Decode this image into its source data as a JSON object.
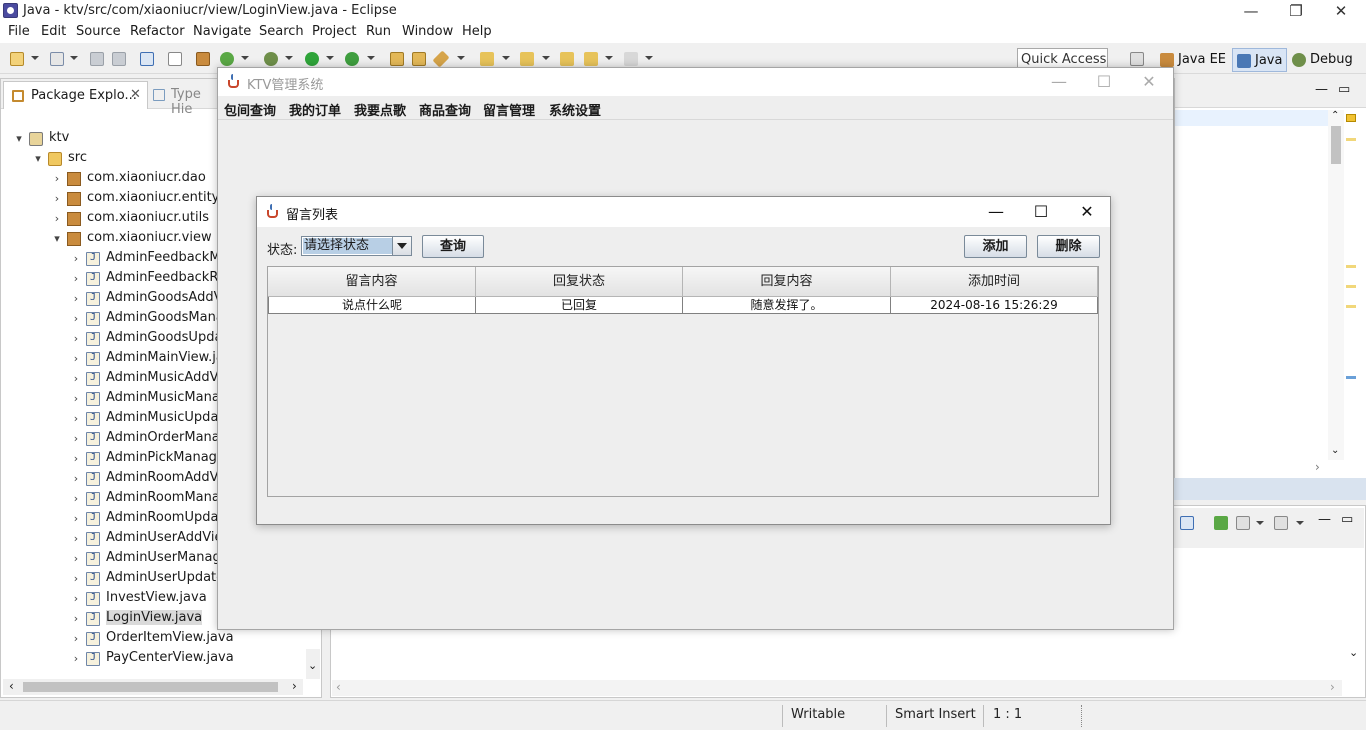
{
  "eclipse": {
    "title": "Java - ktv/src/com/xiaoniucr/view/LoginView.java - Eclipse",
    "menu": [
      "File",
      "Edit",
      "Source",
      "Refactor",
      "Navigate",
      "Search",
      "Project",
      "Run",
      "Window",
      "Help"
    ],
    "quick_access": "Quick Access",
    "perspectives": [
      "Java EE",
      "Java",
      "Debug"
    ],
    "package_explorer": {
      "tab_label": "Package Explo...",
      "tab_close": "✕",
      "other_tab": "Type Hie",
      "tree": [
        {
          "label": "ktv",
          "level": 0,
          "chevron": "▾",
          "icon": "project"
        },
        {
          "label": "src",
          "level": 1,
          "chevron": "▾",
          "icon": "src"
        },
        {
          "label": "com.xiaoniucr.dao",
          "level": 2,
          "chevron": "›",
          "icon": "pkg"
        },
        {
          "label": "com.xiaoniucr.entity",
          "level": 2,
          "chevron": "›",
          "icon": "pkg"
        },
        {
          "label": "com.xiaoniucr.utils",
          "level": 2,
          "chevron": "›",
          "icon": "pkg"
        },
        {
          "label": "com.xiaoniucr.view",
          "level": 2,
          "chevron": "▾",
          "icon": "pkg"
        },
        {
          "label": "AdminFeedbackMa",
          "level": 3,
          "chevron": "›",
          "icon": "file"
        },
        {
          "label": "AdminFeedbackRep",
          "level": 3,
          "chevron": "›",
          "icon": "file"
        },
        {
          "label": "AdminGoodsAddVi",
          "level": 3,
          "chevron": "›",
          "icon": "file"
        },
        {
          "label": "AdminGoodsManag",
          "level": 3,
          "chevron": "›",
          "icon": "file"
        },
        {
          "label": "AdminGoodsUpdat",
          "level": 3,
          "chevron": "›",
          "icon": "file"
        },
        {
          "label": "AdminMainView.java",
          "level": 3,
          "chevron": "›",
          "icon": "file"
        },
        {
          "label": "AdminMusicAddVie",
          "level": 3,
          "chevron": "›",
          "icon": "file"
        },
        {
          "label": "AdminMusicManag",
          "level": 3,
          "chevron": "›",
          "icon": "file"
        },
        {
          "label": "AdminMusicUpdate",
          "level": 3,
          "chevron": "›",
          "icon": "file"
        },
        {
          "label": "AdminOrderManag",
          "level": 3,
          "chevron": "›",
          "icon": "file"
        },
        {
          "label": "AdminPickManageV",
          "level": 3,
          "chevron": "›",
          "icon": "file"
        },
        {
          "label": "AdminRoomAddVie",
          "level": 3,
          "chevron": "›",
          "icon": "file"
        },
        {
          "label": "AdminRoomManag",
          "level": 3,
          "chevron": "›",
          "icon": "file"
        },
        {
          "label": "AdminRoomUpdate",
          "level": 3,
          "chevron": "›",
          "icon": "file"
        },
        {
          "label": "AdminUserAddView",
          "level": 3,
          "chevron": "›",
          "icon": "file"
        },
        {
          "label": "AdminUserManage",
          "level": 3,
          "chevron": "›",
          "icon": "file"
        },
        {
          "label": "AdminUserUpdateV",
          "level": 3,
          "chevron": "›",
          "icon": "file"
        },
        {
          "label": "InvestView.java",
          "level": 3,
          "chevron": "›",
          "icon": "file"
        },
        {
          "label": "LoginView.java",
          "level": 3,
          "chevron": "›",
          "icon": "file",
          "selected": true
        },
        {
          "label": "OrderItemView.java",
          "level": 3,
          "chevron": "›",
          "icon": "file"
        },
        {
          "label": "PayCenterView.java",
          "level": 3,
          "chevron": "›",
          "icon": "file"
        }
      ]
    },
    "statusbar": {
      "writable": "Writable",
      "insert_mode": "Smart Insert",
      "position": "1 : 1"
    }
  },
  "ktv_window": {
    "title": "KTV管理系统",
    "menu": [
      "包间查询",
      "我的订单",
      "我要点歌",
      "商品查询",
      "留言管理",
      "系统设置"
    ]
  },
  "message_window": {
    "title": "留言列表",
    "status_label": "状态:",
    "status_select": "请选择状态",
    "query_button": "查询",
    "add_button": "添加",
    "delete_button": "删除",
    "table": {
      "columns": [
        "留言内容",
        "回复状态",
        "回复内容",
        "添加时间"
      ],
      "rows": [
        [
          "说点什么呢",
          "已回复",
          "随意发挥了。",
          "2024-08-16 15:26:29"
        ]
      ]
    }
  },
  "colors": {
    "selection": "#b8cfe5",
    "active_perspective": "#d9e5f5"
  }
}
